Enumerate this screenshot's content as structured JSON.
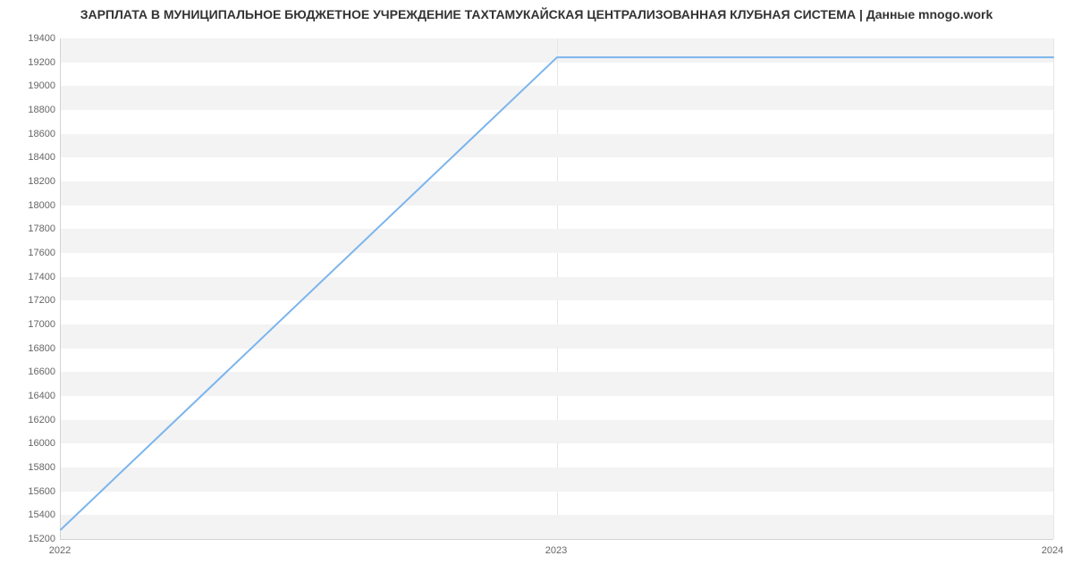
{
  "chart_data": {
    "type": "line",
    "title": "ЗАРПЛАТА В МУНИЦИПАЛЬНОЕ БЮДЖЕТНОЕ УЧРЕЖДЕНИЕ ТАХТАМУКАЙСКАЯ ЦЕНТРАЛИЗОВАННАЯ КЛУБНАЯ СИСТЕМА | Данные mnogo.work",
    "x": [
      2022,
      2023,
      2024
    ],
    "values": [
      15279,
      19242,
      19242
    ],
    "x_ticks": [
      2022,
      2023,
      2024
    ],
    "y_ticks": [
      15200,
      15400,
      15600,
      15800,
      16000,
      16200,
      16400,
      16600,
      16800,
      17000,
      17200,
      17400,
      17600,
      17800,
      18000,
      18200,
      18400,
      18600,
      18800,
      19000,
      19200,
      19400
    ],
    "xlabel": "",
    "ylabel": "",
    "xlim": [
      2022,
      2024
    ],
    "ylim": [
      15200,
      19400
    ],
    "line_color": "#7cb5ec"
  }
}
